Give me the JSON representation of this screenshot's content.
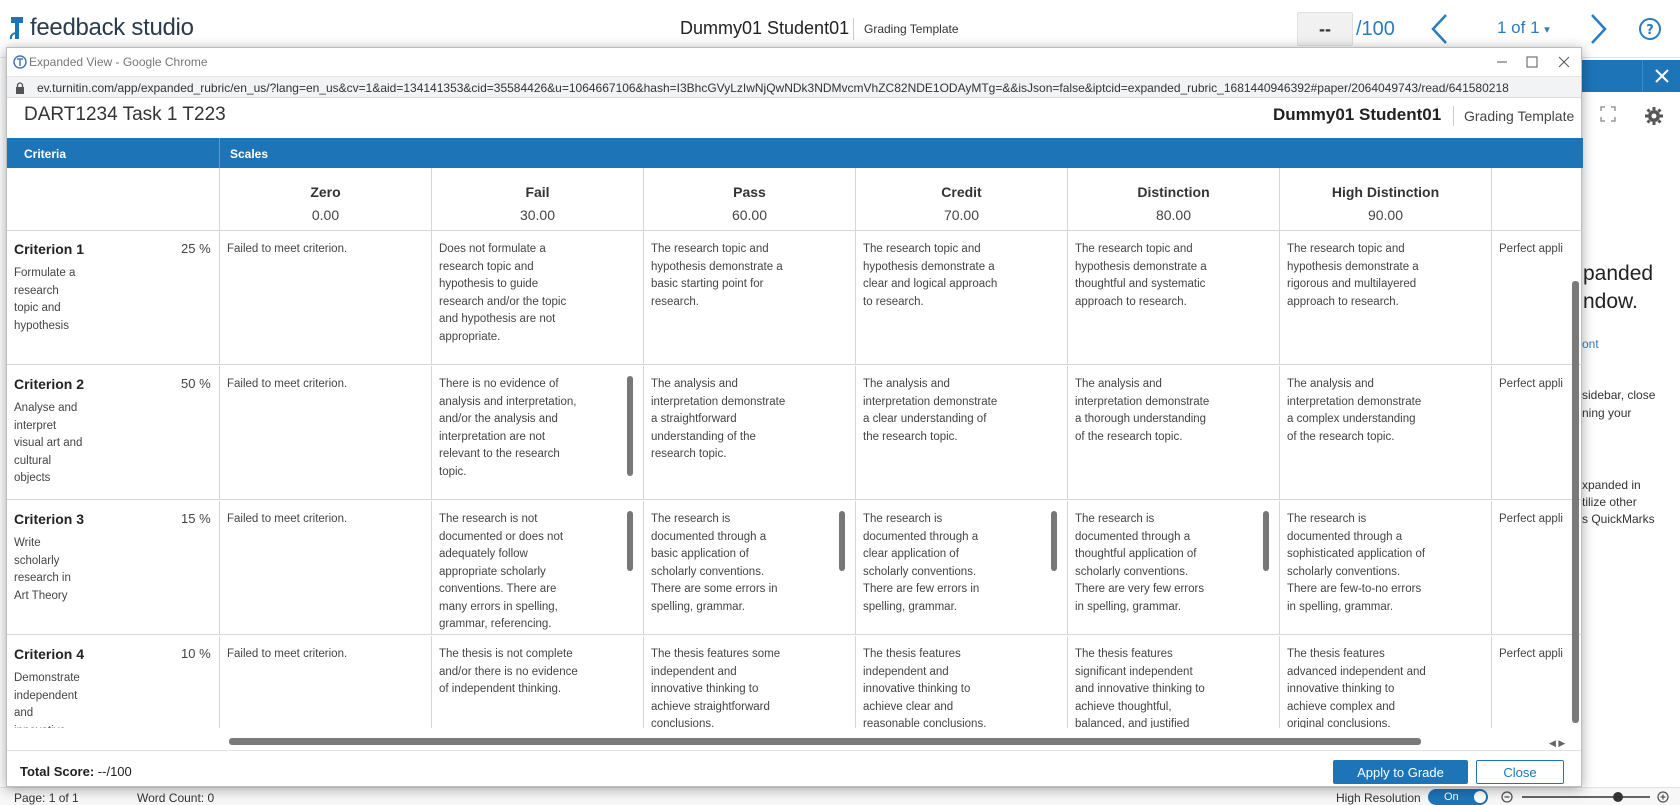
{
  "app": {
    "logo_text": "feedback studio",
    "student_name": "Dummy01 Student01",
    "template_label": "Grading Template",
    "grade_value": "--",
    "grade_max": "/100",
    "page_indicator": "1 of 1",
    "side_panel": {
      "line1": "panded",
      "line2": "ndow.",
      "link": "ont",
      "p1_l1": "sidebar, close",
      "p1_l2": "ning your",
      "p2_l1": "xpanded in",
      "p2_l2": "tilize other",
      "p2_l3": "s QuickMarks"
    },
    "status_bar": {
      "page": "Page: 1 of 1",
      "word_count": "Word Count: 0",
      "high_resolution": "High Resolution",
      "toggle": "On"
    }
  },
  "popup": {
    "window_title": "Expanded View - Google Chrome",
    "url": "ev.turnitin.com/app/expanded_rubric/en_us/?lang=en_us&cv=1&aid=134141353&cid=35584426&u=1064667106&hash=I3BhcGVyLzIwNjQwNDk3NDMvcmVhZC82NDE1ODAyMTg=&&isJson=false&iptcid=expanded_rubric_1681440946392#paper/2064049743/read/641580218",
    "rubric_title": "DART1234 Task 1 T223",
    "student_name": "Dummy01 Student01",
    "template_label": "Grading Template",
    "criteria_header": "Criteria",
    "scales_header": "Scales",
    "scales": [
      {
        "name": "Zero",
        "points": "0.00"
      },
      {
        "name": "Fail",
        "points": "30.00"
      },
      {
        "name": "Pass",
        "points": "60.00"
      },
      {
        "name": "Credit",
        "points": "70.00"
      },
      {
        "name": "Distinction",
        "points": "80.00"
      },
      {
        "name": "High Distinction",
        "points": "90.00"
      },
      {
        "name": "",
        "points": ""
      }
    ],
    "criteria": [
      {
        "name": "Criterion 1",
        "weight": "25 %",
        "description": "Formulate a research topic and hypothesis",
        "cells": [
          "Failed to meet criterion.",
          "Does not formulate a research topic and hypothesis to guide research and/or the topic and hypothesis are not appropriate.",
          "The research topic and hypothesis demonstrate a basic starting point for research.",
          "The research topic and hypothesis demonstrate a clear and logical approach to research.",
          "The research topic and hypothesis demonstrate a thoughtful and systematic approach to research.",
          "The research topic and hypothesis demonstrate a rigorous and multilayered approach to research.",
          "Perfect appli"
        ]
      },
      {
        "name": "Criterion 2",
        "weight": "50 %",
        "description": "Analyse and interpret visual art and cultural objects",
        "cells": [
          "Failed to meet criterion.",
          "There is no evidence of analysis and interpretation, and/or the analysis and interpretation are not relevant to the research topic.",
          "The analysis and interpretation demonstrate a straightforward understanding of the research topic.",
          "The analysis and interpretation demonstrate a clear understanding of the research topic.",
          "The analysis and interpretation demonstrate a thorough understanding of the research topic.",
          "The analysis and interpretation demonstrate a complex understanding of the research topic.",
          "Perfect appli"
        ]
      },
      {
        "name": "Criterion 3",
        "weight": "15 %",
        "description": "Write scholarly research in Art Theory",
        "cells": [
          "Failed to meet criterion.",
          "The research is not documented or does not adequately follow appropriate scholarly conventions. There are many errors in spelling, grammar, referencing.",
          "The research is documented through a basic application of scholarly conventions. There are some errors in spelling, grammar.",
          "The research is documented through a clear application of scholarly conventions. There are few errors in spelling, grammar.",
          "The research is documented through a thoughtful application of scholarly conventions. There are very few errors in spelling, grammar.",
          "The research is documented through a sophisticated application of scholarly conventions. There are few-to-no errors in spelling, grammar.",
          "Perfect appli"
        ]
      },
      {
        "name": "Criterion 4",
        "weight": "10 %",
        "description": "Demonstrate independent and innovative",
        "cells": [
          "Failed to meet criterion.",
          "The thesis is not complete and/or there is no evidence of independent thinking.",
          "The thesis features some independent and innovative thinking to achieve straightforward conclusions.",
          "The thesis features independent and innovative thinking to achieve clear and reasonable conclusions.",
          "The thesis features significant independent and innovative thinking to achieve thoughtful, balanced, and justified conclusions.",
          "The thesis features advanced independent and innovative thinking to achieve complex and original conclusions.",
          "Perfect appli"
        ]
      }
    ],
    "total_label": "Total Score:",
    "total_value": "--/100",
    "apply_button": "Apply to Grade",
    "close_button": "Close"
  },
  "colors": {
    "accent": "#1d75b8",
    "link": "#2b7bc0"
  }
}
